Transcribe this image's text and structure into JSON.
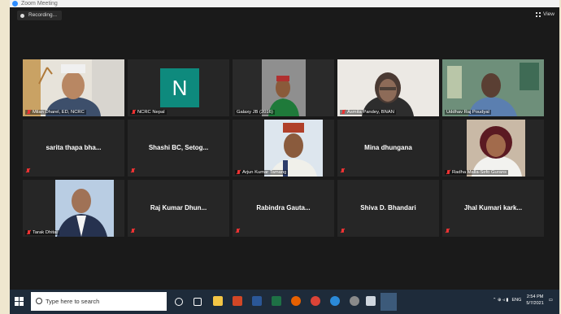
{
  "window": {
    "title": "Zoom Meeting"
  },
  "meeting": {
    "recording_label": "Recording...",
    "view_label": "View"
  },
  "participants": [
    {
      "name": "Milan Dharel, ED, NCRC",
      "video": true,
      "speaking": false
    },
    {
      "name": "NCRC Nepal",
      "video": false,
      "avatar_letter": "N",
      "speaking": false
    },
    {
      "name": "Galaxy JB (2016)",
      "video": true,
      "speaking": false
    },
    {
      "name": "Asmita Pandey, BNAN",
      "video": true,
      "speaking": false
    },
    {
      "name": "Uddhav Raj Poudyal",
      "video": true,
      "speaking": true
    },
    {
      "name": "sarita thapa bha...",
      "video": false,
      "speaking": false
    },
    {
      "name": "Shashi BC, Setog...",
      "video": false,
      "speaking": false
    },
    {
      "name": "Arjun Kumar Tamang",
      "video": true,
      "speaking": false
    },
    {
      "name": "Mina dhungana",
      "video": false,
      "speaking": false
    },
    {
      "name": "Radha Malla-Sefo Gurans",
      "video": true,
      "speaking": false
    },
    {
      "name": "Tarak Dhital",
      "video": true,
      "speaking": false
    },
    {
      "name": "Raj Kumar Dhun...",
      "video": false,
      "speaking": false
    },
    {
      "name": "Rabindra Gauta...",
      "video": false,
      "speaking": false
    },
    {
      "name": "Shiva D. Bhandari",
      "video": false,
      "speaking": false
    },
    {
      "name": "Jhal Kumari kark...",
      "video": false,
      "speaking": false
    }
  ],
  "taskbar": {
    "search_placeholder": "Type here to search",
    "language": "ENG",
    "time": "2:54 PM",
    "date": "5/7/2021"
  },
  "colors": {
    "speaking_border": "#7cd33a",
    "mute_red": "#e33333",
    "avatar_teal": "#0e8a7d",
    "taskbar_bg": "#1e2b3a"
  }
}
